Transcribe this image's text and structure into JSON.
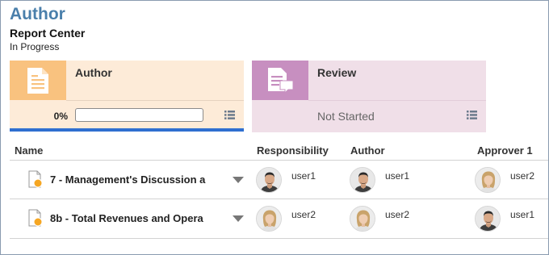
{
  "header": {
    "title": "Author",
    "subtitle": "Report Center",
    "status": "In Progress"
  },
  "stages": {
    "author": {
      "name": "Author",
      "progress_label": "0%",
      "progress_fraction": 0,
      "icon": "document-icon",
      "accent": "#2f6fd0"
    },
    "review": {
      "name": "Review",
      "status": "Not Started",
      "icon": "review-document-icon"
    }
  },
  "table": {
    "columns": [
      "Name",
      "Responsibility",
      "Author",
      "Approver 1"
    ],
    "rows": [
      {
        "name": "7 - Management's Discussion a",
        "responsibility": {
          "user": "user1",
          "avatar": "male"
        },
        "author": {
          "user": "user1",
          "avatar": "male"
        },
        "approver": {
          "user": "user2",
          "avatar": "female"
        }
      },
      {
        "name": "8b - Total Revenues and Opera",
        "responsibility": {
          "user": "user2",
          "avatar": "female"
        },
        "author": {
          "user": "user2",
          "avatar": "female"
        },
        "approver": {
          "user": "user1",
          "avatar": "male"
        }
      }
    ]
  },
  "colors": {
    "title": "#4a7fab",
    "author_stage_bg": "#fdebd8",
    "author_icon_bg": "#f9c27f",
    "review_stage_bg": "#f0dfe8",
    "review_icon_bg": "#c78fc0",
    "status_dot": "#f5a623"
  }
}
